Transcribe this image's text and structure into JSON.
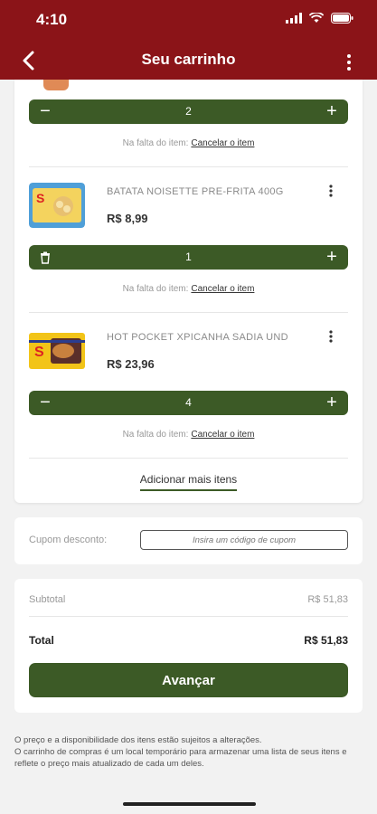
{
  "status_bar": {
    "time": "4:10"
  },
  "header": {
    "title": "Seu carrinho"
  },
  "cart": {
    "top_item": {
      "quantity": "2"
    },
    "missing_prefix": "Na falta do item:",
    "missing_action": "Cancelar o item",
    "items": [
      {
        "name": "BATATA NOISETTE PRE-FRITA 400G",
        "price": "R$ 8,99",
        "quantity": "1"
      },
      {
        "name": "HOT POCKET XPICANHA SADIA UND",
        "price": "R$ 23,96",
        "quantity": "4"
      }
    ],
    "add_more": "Adicionar mais itens"
  },
  "coupon": {
    "label": "Cupom desconto:",
    "placeholder": "Insira um código de cupom"
  },
  "totals": {
    "subtotal_label": "Subtotal",
    "subtotal_value": "R$ 51,83",
    "total_label": "Total",
    "total_value": "R$ 51,83",
    "advance_label": "Avançar"
  },
  "disclaimer": {
    "line1": "O preço e a disponibilidade dos itens estão sujeitos a alterações.",
    "line2": "O carrinho de compras é um local temporário para armazenar uma lista de seus itens e reflete o preço mais atualizado de cada um deles."
  },
  "colors": {
    "brand": "#8b1418",
    "accent": "#3c5a26"
  },
  "icons": [
    "back-arrow-icon",
    "more-vertical-icon",
    "minus-icon",
    "plus-icon",
    "trash-icon",
    "wifi-icon",
    "battery-icon",
    "signal-icon"
  ]
}
